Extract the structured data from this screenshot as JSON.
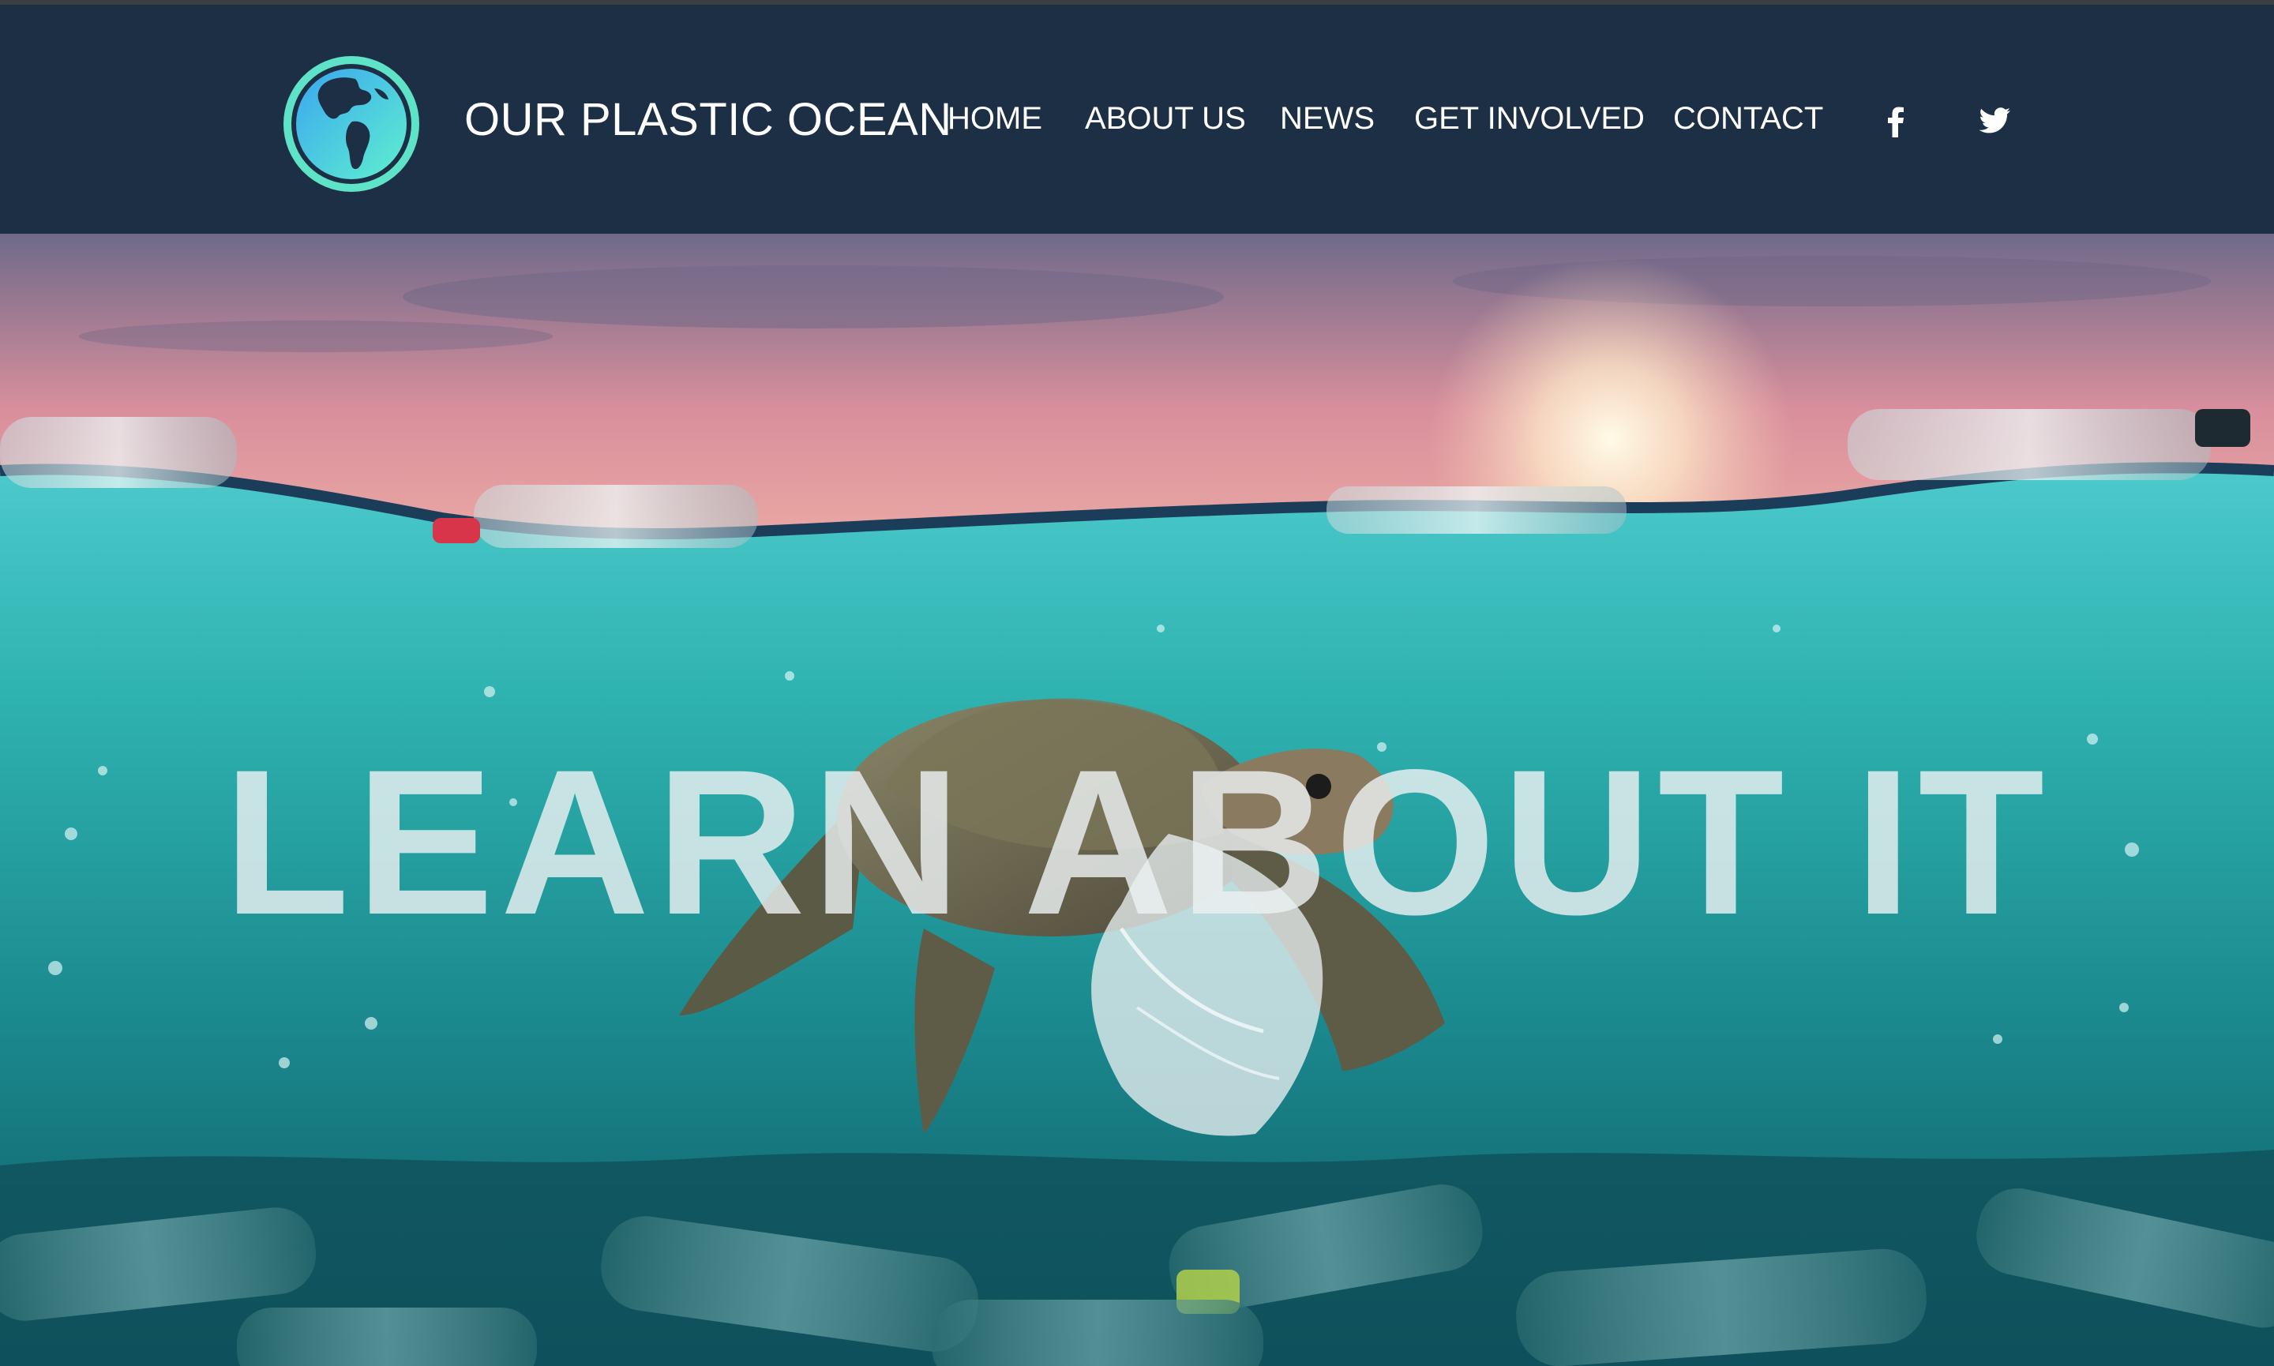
{
  "site": {
    "name": "OUR PLASTIC OCEAN",
    "logo_icon": "globe-icon"
  },
  "nav": {
    "items": [
      {
        "label": "HOME"
      },
      {
        "label": "ABOUT US"
      },
      {
        "label": "NEWS"
      },
      {
        "label": "GET INVOLVED"
      },
      {
        "label": "CONTACT"
      }
    ],
    "social": [
      {
        "icon": "facebook-icon"
      },
      {
        "icon": "twitter-icon"
      }
    ]
  },
  "hero": {
    "headline": "LEARN ABOUT IT",
    "image": "sea-turtle-plastic-bag-icon"
  },
  "colors": {
    "nav_background": "#1c2f45",
    "logo_ring": "#5fe3c8",
    "logo_globe": "#3fb7e8",
    "sky_top": "#6f6a8a",
    "sky_sunset": "#f3b6a8",
    "water": "#2fb3b0",
    "deep_water": "#0f5a66"
  }
}
